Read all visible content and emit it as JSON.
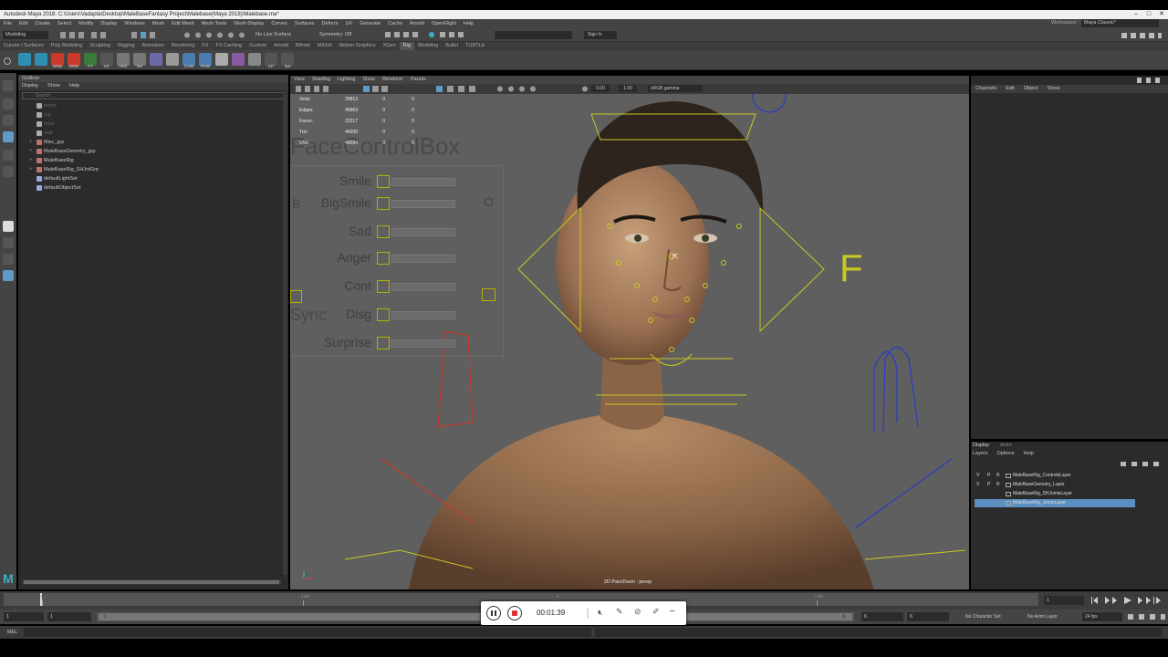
{
  "app": {
    "title": "Autodesk Maya 2018: C:\\Users\\Vadapta\\Desktop\\MaleBaseFantasy Project\\Malebase(Maya 2018)\\Malebase.ma*",
    "workspace_label": "Workspace :",
    "workspace_value": "Maya Classic*",
    "sign_in": "Sign In"
  },
  "menubar": [
    "File",
    "Edit",
    "Create",
    "Select",
    "Modify",
    "Display",
    "Windows",
    "Mesh",
    "Edit Mesh",
    "Mesh Tools",
    "Mesh Display",
    "Curves",
    "Surfaces",
    "Deform",
    "UV",
    "Generate",
    "Cache",
    "Arnold",
    "OpenFlight",
    "Help"
  ],
  "statusline": {
    "mode": "Modeling",
    "live_surface": "No Live Surface",
    "symmetry": "Symmetry: Off"
  },
  "shelf_tabs": [
    "Curves / Surfaces",
    "Poly Modeling",
    "Sculpting",
    "Rigging",
    "Animation",
    "Rendering",
    "FX",
    "FX Caching",
    "Custom",
    "Arnold",
    "Bifrost",
    "MASH",
    "Motion Graphics",
    "XGen",
    "Rig",
    "Modeling",
    "Bullet",
    "TURTLE"
  ],
  "shelf_active_tab": "Rig",
  "shelf_icons": [
    {
      "label": "",
      "color": "#2f8fb0"
    },
    {
      "label": "",
      "color": "#2f8fb0"
    },
    {
      "label": "RRM",
      "color": "#c83a2a"
    },
    {
      "label": "RRM",
      "color": "#c83a2a"
    },
    {
      "label": "FT",
      "color": "#3a7a3a"
    },
    {
      "label": "CP",
      "color": "#555555"
    },
    {
      "label": "Hist",
      "color": "#777777"
    },
    {
      "label": "NH",
      "color": "#777777"
    },
    {
      "label": "",
      "color": "#6a6aaa"
    },
    {
      "label": "",
      "color": "#999999"
    },
    {
      "label": "CVW",
      "color": "#4a7ab0"
    },
    {
      "label": "PVW",
      "color": "#4a7ab0"
    },
    {
      "label": "",
      "color": "#aaaaaa"
    },
    {
      "label": "",
      "color": "#8a5aa0"
    },
    {
      "label": "",
      "color": "#888888"
    },
    {
      "label": "CP",
      "color": "#555555"
    },
    {
      "label": "Set",
      "color": "#555555"
    }
  ],
  "outliner": {
    "title": "Outliner",
    "menu": [
      "Display",
      "Show",
      "Help"
    ],
    "search_placeholder": "Search...",
    "items": [
      {
        "label": "persp",
        "dim": true,
        "type": "camera"
      },
      {
        "label": "top",
        "dim": true,
        "type": "camera"
      },
      {
        "label": "front",
        "dim": true,
        "type": "camera"
      },
      {
        "label": "side",
        "dim": true,
        "type": "camera"
      },
      {
        "label": "Misc_grp",
        "dim": false,
        "type": "group"
      },
      {
        "label": "MaleBaseGemetry_grp",
        "dim": false,
        "type": "group"
      },
      {
        "label": "MaleBaseRig",
        "dim": false,
        "type": "group"
      },
      {
        "label": "MaleBaseRig_SHJntGrp",
        "dim": false,
        "type": "group"
      },
      {
        "label": "defaultLightSet",
        "dim": false,
        "type": "set"
      },
      {
        "label": "defaultObjectSet",
        "dim": false,
        "type": "set"
      }
    ]
  },
  "viewport": {
    "menu": [
      "View",
      "Shading",
      "Lighting",
      "Show",
      "Renderer",
      "Panels"
    ],
    "exposure": "0.00",
    "gamma": "1.00",
    "color_space": "sRGB gamma",
    "camera_label": "2D Pan/Zoom : persp",
    "hud": [
      {
        "label": "Verts:",
        "a": "28813",
        "b": "0",
        "c": "0"
      },
      {
        "label": "Edges:",
        "a": "49963",
        "b": "0",
        "c": "0"
      },
      {
        "label": "Faces:",
        "a": "22217",
        "b": "0",
        "c": "0"
      },
      {
        "label": "Tris:",
        "a": "44200",
        "b": "0",
        "c": "0"
      },
      {
        "label": "UVs:",
        "a": "48594",
        "b": "0",
        "c": "0"
      }
    ],
    "face_control_title": "FaceControlBox",
    "face_controls": [
      "Smile",
      "BigSmile",
      "Sad",
      "Anger",
      "Cont",
      "Disg",
      "Surprise"
    ],
    "side_letters": {
      "left": "B",
      "right": "O",
      "f": "F",
      "sync": "Sync"
    }
  },
  "channel_box": {
    "menu": [
      "Channels",
      "Edit",
      "Object",
      "Show"
    ]
  },
  "layers": {
    "tabs": [
      "Display",
      "Anim"
    ],
    "menu": [
      "Layers",
      "Options",
      "Help"
    ],
    "rows": [
      {
        "v": "V",
        "p": "P",
        "r": "R",
        "name": "MaleBaseRig_ControlsLayer",
        "selected": false
      },
      {
        "v": "V",
        "p": "P",
        "r": "R",
        "name": "MaleBaseGemetry_Layer",
        "selected": false
      },
      {
        "v": "",
        "p": "",
        "r": "",
        "name": "MaleBaseRig_SHJointsLayer",
        "selected": false
      },
      {
        "v": "",
        "p": "",
        "r": "",
        "name": "MaleBaseRig_JointsLayer",
        "selected": true
      }
    ]
  },
  "timeline": {
    "ticks": [
      "1",
      "2.50",
      "5",
      "7.50"
    ],
    "current_frame": "1"
  },
  "range": {
    "start": "1",
    "start_inner": "1",
    "end_inner": "6",
    "end": "6",
    "end_outer": "6",
    "character_set": "No Character Set",
    "anim_layer": "No Anim Layer",
    "fps": "24 fps"
  },
  "command_line": {
    "label": "MEL"
  },
  "recorder": {
    "time": "00:01:39"
  },
  "colors": {
    "accent": "#5e9bc6",
    "selected_layer": "#5a8fbf",
    "rig_yellow": "#c8c820",
    "rig_blue": "#2a3ac8",
    "rig_red": "#c83a2a"
  }
}
